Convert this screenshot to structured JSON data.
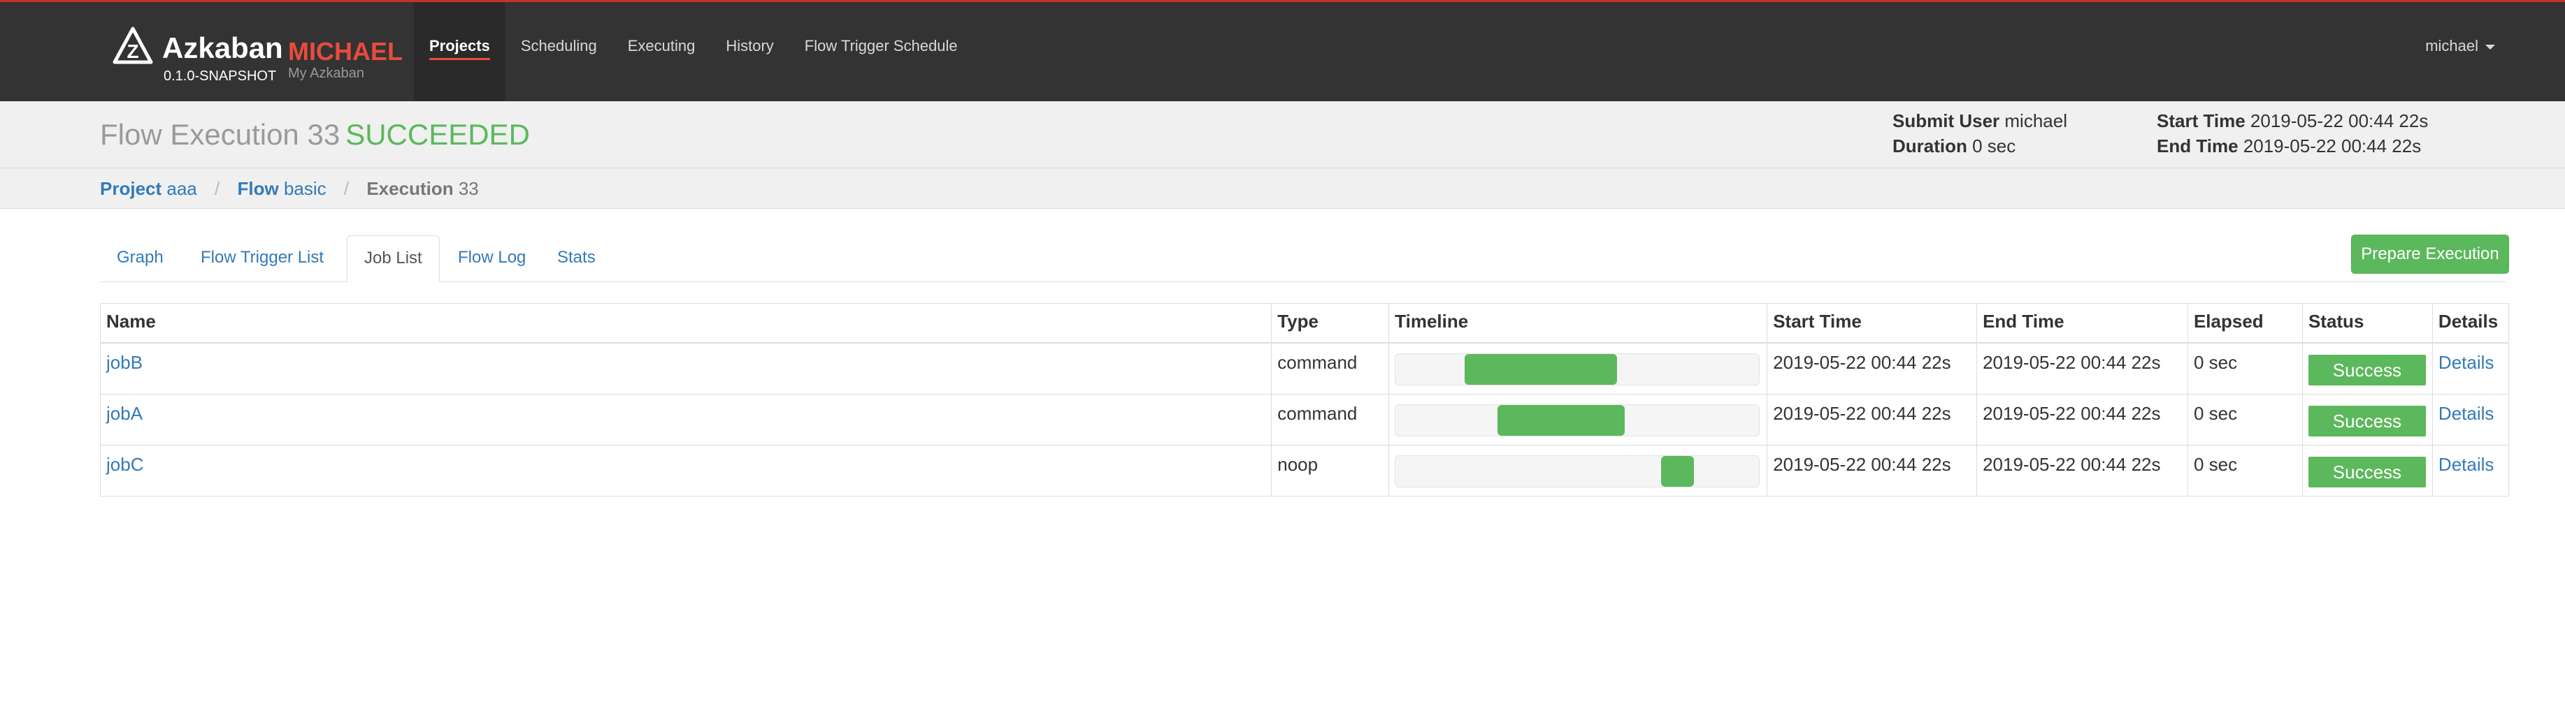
{
  "brand": {
    "name": "Azkaban",
    "env": "MICHAEL",
    "version": "0.1.0-SNAPSHOT",
    "subtitle": "My Azkaban",
    "accent_color": "#e74c3c"
  },
  "nav": {
    "items": [
      {
        "label": "Projects",
        "active": true
      },
      {
        "label": "Scheduling"
      },
      {
        "label": "Executing"
      },
      {
        "label": "History"
      },
      {
        "label": "Flow Trigger Schedule"
      }
    ],
    "user": "michael"
  },
  "header": {
    "title": "Flow Execution 33",
    "status": "SUCCEEDED",
    "status_color": "#5cb85c",
    "submit_user_label": "Submit User",
    "submit_user": "michael",
    "duration_label": "Duration",
    "duration": "0 sec",
    "start_time_label": "Start Time",
    "start_time": "2019-05-22 00:44 22s",
    "end_time_label": "End Time",
    "end_time": "2019-05-22 00:44 22s"
  },
  "breadcrumb": {
    "project_label": "Project",
    "project": "aaa",
    "flow_label": "Flow",
    "flow": "basic",
    "execution_label": "Execution",
    "execution": "33"
  },
  "tabs": [
    {
      "label": "Graph"
    },
    {
      "label": "Flow Trigger List"
    },
    {
      "label": "Job List",
      "active": true
    },
    {
      "label": "Flow Log"
    },
    {
      "label": "Stats"
    }
  ],
  "prepare_button": "Prepare Execution",
  "table": {
    "columns": [
      "Name",
      "Type",
      "Timeline",
      "Start Time",
      "End Time",
      "Elapsed",
      "Status",
      "Details"
    ],
    "rows": [
      {
        "name": "jobB",
        "type": "command",
        "timeline_start": 0.19,
        "timeline_end": 0.61,
        "start": "2019-05-22 00:44 22s",
        "end": "2019-05-22 00:44 22s",
        "elapsed": "0 sec",
        "status": "Success",
        "details": "Details"
      },
      {
        "name": "jobA",
        "type": "command",
        "timeline_start": 0.28,
        "timeline_end": 0.63,
        "start": "2019-05-22 00:44 22s",
        "end": "2019-05-22 00:44 22s",
        "elapsed": "0 sec",
        "status": "Success",
        "details": "Details"
      },
      {
        "name": "jobC",
        "type": "noop",
        "timeline_start": 0.73,
        "timeline_end": 0.82,
        "start": "2019-05-22 00:44 22s",
        "end": "2019-05-22 00:44 22s",
        "elapsed": "0 sec",
        "status": "Success",
        "details": "Details"
      }
    ]
  }
}
